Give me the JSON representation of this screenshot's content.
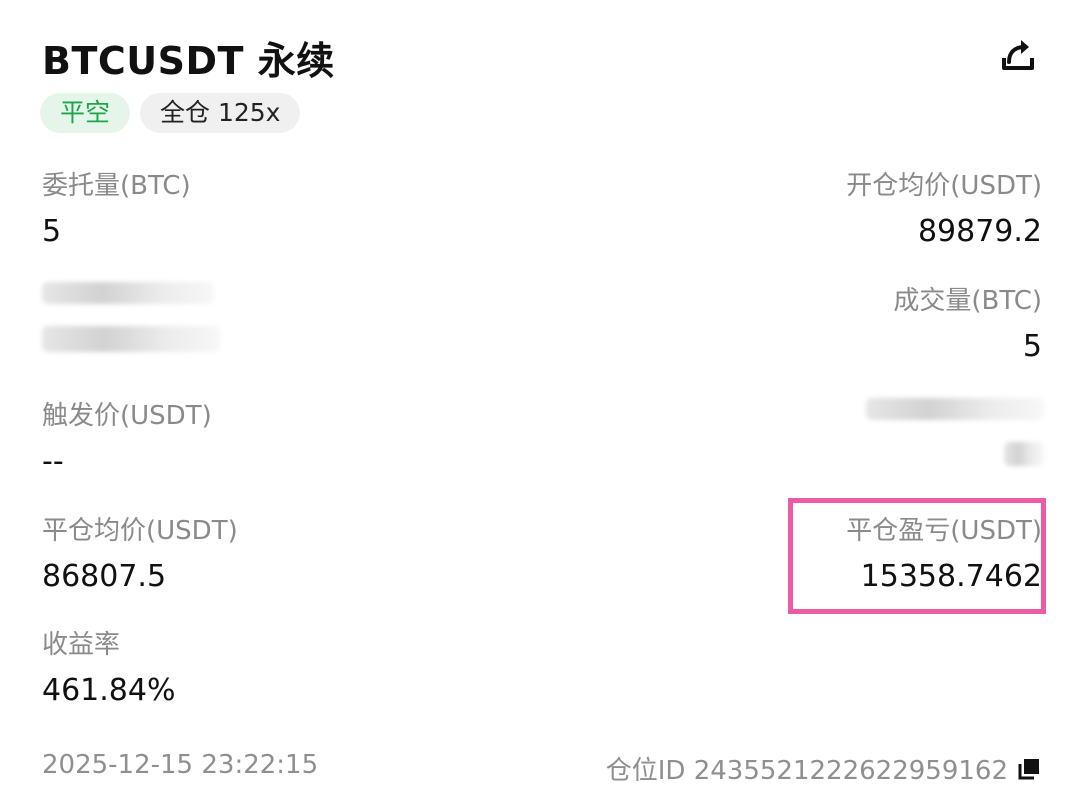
{
  "header": {
    "title": "BTCUSDT 永续",
    "share_icon": "share-icon"
  },
  "tags": {
    "side": "平空",
    "margin": "全仓 125x"
  },
  "fields": {
    "order_qty": {
      "label": "委托量(BTC)",
      "value": "5"
    },
    "open_avg_price": {
      "label": "开仓均价(USDT)",
      "value": "89879.2"
    },
    "filled_qty": {
      "label": "成交量(BTC)",
      "value": "5"
    },
    "trigger_price": {
      "label": "触发价(USDT)",
      "value": "--"
    },
    "close_avg_price": {
      "label": "平仓均价(USDT)",
      "value": "86807.5"
    },
    "close_pnl": {
      "label": "平仓盈亏(USDT)",
      "value": "15358.7462"
    },
    "yield_rate": {
      "label": "收益率",
      "value": "461.84%"
    }
  },
  "footer": {
    "timestamp": "2025-12-15 23:22:15",
    "position_id_label": "仓位ID 2435521222622959162",
    "copy_icon": "copy-icon"
  },
  "colors": {
    "side_tag_text": "#1fa64a",
    "side_tag_bg": "#e6f5ea",
    "highlight_border": "#ec5ca6",
    "label_gray": "#8a8a8a"
  }
}
